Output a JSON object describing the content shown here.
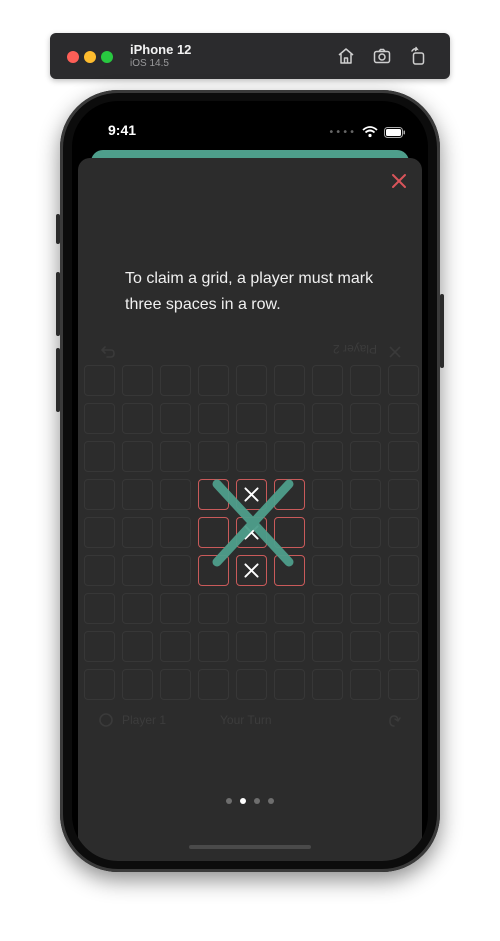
{
  "simulator": {
    "device_name": "iPhone 12",
    "os_version": "iOS 14.5",
    "icons": [
      "home-icon",
      "screenshot-icon",
      "rotate-icon"
    ]
  },
  "status_bar": {
    "time": "9:41",
    "icons": [
      "wifi-icon",
      "battery-icon"
    ]
  },
  "tutorial": {
    "text": "To claim a grid, a player must mark three spaces in a row.",
    "close_icon": "close-icon",
    "page_count": 4,
    "active_page": 2
  },
  "background_board": {
    "player2_label": "Player 2",
    "player1_label": "Player 1",
    "center_label": "Your Turn"
  },
  "colors": {
    "sheet": "#2c2c2c",
    "accent": "#4e9e8b",
    "highlight": "#c95a5a",
    "close": "#d9545a"
  }
}
